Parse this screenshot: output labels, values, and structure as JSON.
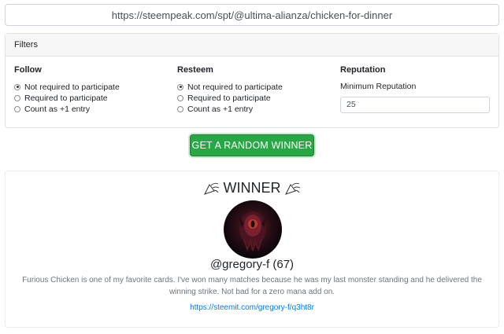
{
  "url": "https://steempeak.com/spt/@ultima-alianza/chicken-for-dinner",
  "filters": {
    "header": "Filters",
    "follow": {
      "title": "Follow",
      "options": [
        "Not required to participate",
        "Required to participate",
        "Count as +1 entry"
      ],
      "selected": 0
    },
    "resteem": {
      "title": "Resteem",
      "options": [
        "Not required to participate",
        "Required to participate",
        "Count as +1 entry"
      ],
      "selected": 0
    },
    "reputation": {
      "title": "Reputation",
      "label": "Minimum Reputation",
      "value": "25"
    }
  },
  "button": {
    "label": "GET A RANDOM WINNER",
    "color": "#28a745"
  },
  "winner": {
    "title": "WINNER",
    "username": "@gregory-f (67)",
    "description": "Furious Chicken is one of my favorite cards. I've won many matches because he was my last monster standing and he delivered the winning strike. Not bad for a zero mana add on.",
    "link": "https://steemit.com/gregory-f/q3ht8r"
  }
}
